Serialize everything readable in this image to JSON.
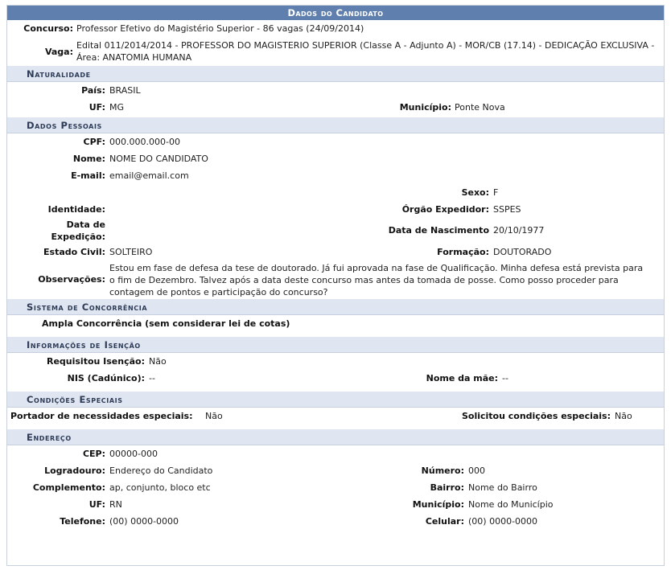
{
  "title": "Dados do Candidato",
  "top": {
    "concurso_label": "Concurso:",
    "concurso_value": "Professor Efetivo do Magistério Superior - 86 vagas (24/09/2014)",
    "vaga_label": "Vaga:",
    "vaga_value": "Edital 011/2014/2014 - PROFESSOR DO MAGISTERIO SUPERIOR (Classe A - Adjunto A) - MOR/CB (17.14) - DEDICAÇÃO EXCLUSIVA - Área: ANATOMIA HUMANA"
  },
  "naturalidade": {
    "heading": "Naturalidade",
    "pais_label": "País:",
    "pais_value": "BRASIL",
    "uf_label": "UF:",
    "uf_value": "MG",
    "municipio_label": "Município:",
    "municipio_value": "Ponte Nova"
  },
  "pessoais": {
    "heading": "Dados Pessoais",
    "cpf_label": "CPF:",
    "cpf_value": "000.000.000-00",
    "nome_label": "Nome:",
    "nome_value": "NOME DO CANDIDATO",
    "email_label": "E-mail:",
    "email_value": "email@email.com",
    "sexo_label": "Sexo:",
    "sexo_value": "F",
    "identidade_label": "Identidade:",
    "identidade_value": "",
    "orgao_label": "Órgão Expedidor:",
    "orgao_value": "SSPES",
    "data_exp_label": "Data de Expedição:",
    "data_exp_value": "",
    "nascimento_label": "Data de Nascimento",
    "nascimento_value": "20/10/1977",
    "civil_label": "Estado Civil:",
    "civil_value": "SOLTEIRO",
    "formacao_label": "Formação:",
    "formacao_value": "DOUTORADO",
    "obs_label": "Observações:",
    "obs_value": "Estou em fase de defesa da tese de doutorado. Já fui aprovada na fase de Qualificação. Minha defesa está prevista para o fim de Dezembro. Talvez após a data deste concurso mas antes da tomada de posse. Como posso proceder para contagem de pontos e participação do concurso?"
  },
  "concorrencia": {
    "heading": "Sistema de Concorrência",
    "value": "Ampla Concorrência (sem considerar lei de cotas)"
  },
  "isencao": {
    "heading": "Informações de Isenção",
    "requisitou_label": "Requisitou Isenção:",
    "requisitou_value": "Não",
    "nis_label": "NIS (Cadúnico):",
    "nis_value": "--",
    "mae_label": "Nome da mãe:",
    "mae_value": "--"
  },
  "especiais": {
    "heading": "Condições Especiais",
    "portador_label": "Portador de necessidades especiais:",
    "portador_value": "Não",
    "solicitou_label": "Solicitou condições especiais:",
    "solicitou_value": "Não"
  },
  "endereco": {
    "heading": "Endereço",
    "cep_label": "CEP:",
    "cep_value": "00000-000",
    "logradouro_label": "Logradouro:",
    "logradouro_value": "Endereço do Candidato",
    "numero_label": "Número:",
    "numero_value": "000",
    "complemento_label": "Complemento:",
    "complemento_value": "ap, conjunto, bloco etc",
    "bairro_label": "Bairro:",
    "bairro_value": "Nome do Bairro",
    "uf_label": "UF:",
    "uf_value": "RN",
    "municipio_label": "Município:",
    "municipio_value": "Nome do Município",
    "telefone_label": "Telefone:",
    "telefone_value": "(00) 0000-0000",
    "celular_label": "Celular:",
    "celular_value": "(00) 0000-0000"
  }
}
